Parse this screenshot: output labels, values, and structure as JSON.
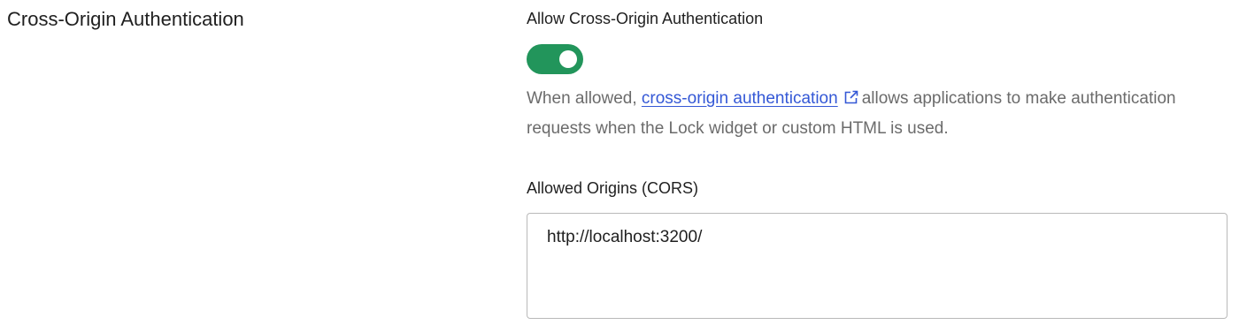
{
  "section": {
    "title": "Cross-Origin Authentication"
  },
  "cross_origin": {
    "label": "Allow Cross-Origin Authentication",
    "toggle_on": true,
    "toggle_color": "#22955b",
    "help_prefix": "When allowed, ",
    "help_link_text": "cross-origin authentication",
    "help_link_icon": "external-link-icon",
    "help_suffix": "allows applications to make authentication requests when the Lock widget or custom HTML is used."
  },
  "allowed_origins": {
    "label": "Allowed Origins (CORS)",
    "value": "http://localhost:3200/"
  }
}
